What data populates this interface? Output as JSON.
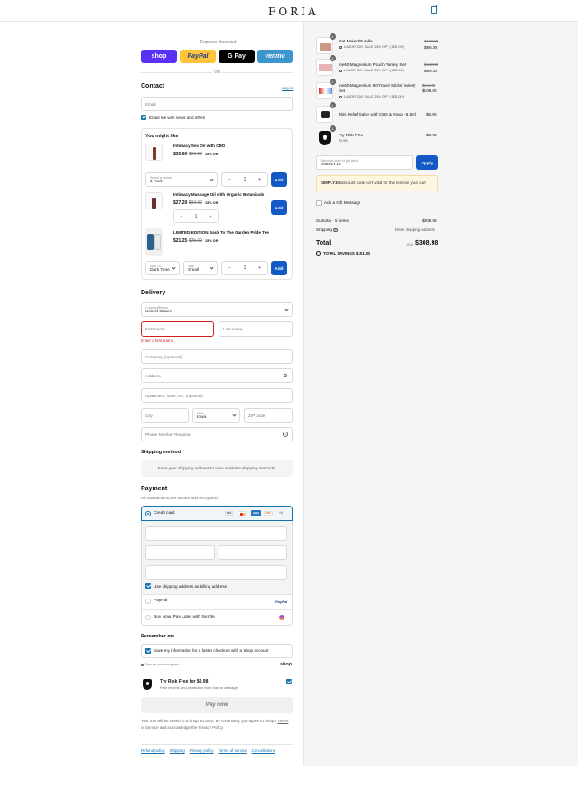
{
  "header": {
    "logo": "FORIA"
  },
  "express": {
    "label": "Express checkout",
    "or": "OR",
    "shop": "shop",
    "paypal": "PayPal",
    "gpay": "G Pay",
    "venmo": "venmo"
  },
  "contact": {
    "title": "Contact",
    "login": "Log in",
    "email_placeholder": "Email",
    "news_label": "Email me with news and offers",
    "news_checked": true
  },
  "upsell": {
    "title": "You might like",
    "products": [
      {
        "name": "Intimacy Sex Oil with CBD",
        "price": "$30.60",
        "compare": "$36.00",
        "pct": "15% Off",
        "variant_label": "Select a variant",
        "variant_value": "1 Pack",
        "qty": "1",
        "add": "Add"
      },
      {
        "name": "Intimacy Massage Oil with Organic Botanicals",
        "price": "$27.20",
        "compare": "$32.00",
        "pct": "15% Off",
        "qty": "1",
        "add": "Add"
      },
      {
        "name": "LIMITED-EDITION Back To The Garden Pride Tee",
        "price": "$21.25",
        "compare": "$25.00",
        "pct": "15% Off",
        "skin_label": "Skin To...",
        "skin_value": "Dark Tone",
        "size_label": "Size",
        "size_value": "Small",
        "qty": "1",
        "add": "Add"
      }
    ]
  },
  "delivery": {
    "title": "Delivery",
    "country_label": "Country/Region",
    "country": "United States",
    "first": "First name",
    "last": "Last name",
    "first_error": "Enter a first name",
    "company": "Company (optional)",
    "address": "Address",
    "apt": "Apartment, suite, etc. (optional)",
    "city": "City",
    "state_label": "State",
    "state": "Iowa",
    "zip": "ZIP code",
    "phone": "Phone Number Required"
  },
  "shipping_method": {
    "title": "Shipping method",
    "text": "Enter your shipping address to view available shipping methods."
  },
  "payment": {
    "title": "Payment",
    "subtitle": "All transactions are secure and encrypted.",
    "credit": "Credit card",
    "billing": "Use shipping address as billing address",
    "paypal": "PayPal",
    "sezzle": "Buy Now, Pay Later with Sezzle",
    "cards": [
      "VISA",
      "MC",
      "AMEX",
      "DISC",
      "+8"
    ]
  },
  "remember": {
    "title": "Remember me",
    "save": "Save my information for a faster checkout with a Shop account",
    "secure": "Secure and encrypted",
    "shop": "shop"
  },
  "risk": {
    "title": "Try Risk Free for $0.98",
    "sub": "Free returns and protection from loss or damage",
    "checked": true
  },
  "paynow": "Pay now",
  "legal": {
    "pre": "Your info will be saved to a Shop account. By continuing, you agree to Shop's ",
    "tos": "Terms of Service",
    "mid": " and acknowledge the ",
    "pp": "Privacy Policy",
    "end": "."
  },
  "footer": [
    "Refund policy",
    "Shipping",
    "Privacy policy",
    "Terms of service",
    "Cancellations"
  ],
  "order": {
    "items": [
      {
        "qty": "1",
        "name": "Get Naked Bundle",
        "sub": "LABOR DAY SALE 25% OFF (-$32.00)",
        "compare": "$128.00",
        "price": "$96.00"
      },
      {
        "qty": "1",
        "name": "me60 Magnesium Pouch Variety Set",
        "sub": "LABOR DAY SALE 25% OFF (-$33.00)",
        "compare": "$132.00",
        "price": "$99.00"
      },
      {
        "qty": "1",
        "name": "me60 Magnesium 90 Travel Sticks Variety Set",
        "sub": "LABOR DAY SALE 25% OFF (-$36.00)",
        "compare": "$144.00",
        "price": "$108.00"
      },
      {
        "qty": "1",
        "name": "Mini Relief Salve with CBD & Kava - 8.5ml",
        "sub": "",
        "compare": "",
        "price": "$5.00"
      },
      {
        "qty": "1",
        "name": "Try Risk Free",
        "sub": "$0.98",
        "compare": "",
        "price": "$0.98"
      }
    ],
    "discount_label": "Discount code or gift card",
    "discount_value": "SIMPLY10",
    "apply": "Apply",
    "warning_code": "SIMPLY10",
    "warning_text": " discount code isn't valid for the items in your cart",
    "gift": "Add a Gift Message",
    "subtotal_label": "Subtotal · 5 items",
    "subtotal": "$308.98",
    "shipping_label": "Shipping",
    "shipping": "Enter shipping address",
    "total_label": "Total",
    "currency": "USD",
    "total": "$308.98",
    "savings_label": "TOTAL SAVINGS",
    "savings": "$101.00"
  }
}
